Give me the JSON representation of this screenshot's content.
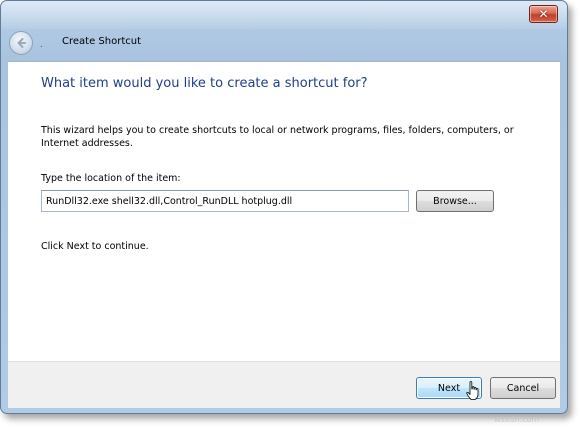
{
  "window": {
    "title": "Create Shortcut",
    "close_label": "✕"
  },
  "content": {
    "heading": "What item would you like to create a shortcut for?",
    "description": "This wizard helps you to create shortcuts to local or network programs, files, folders, computers, or Internet addresses.",
    "location_label": "Type the location of the item:",
    "location_value": "RunDll32.exe shell32.dll,Control_RunDLL hotplug.dll",
    "browse_label": "Browse...",
    "continue_text": "Click Next to continue."
  },
  "footer": {
    "next_label": "Next",
    "cancel_label": "Cancel"
  },
  "watermark": "wsxdn.com",
  "colors": {
    "heading": "#1e3f8c",
    "frame": "#b0c9e3",
    "close": "#c2402a",
    "default_button": "#bee6fd"
  }
}
